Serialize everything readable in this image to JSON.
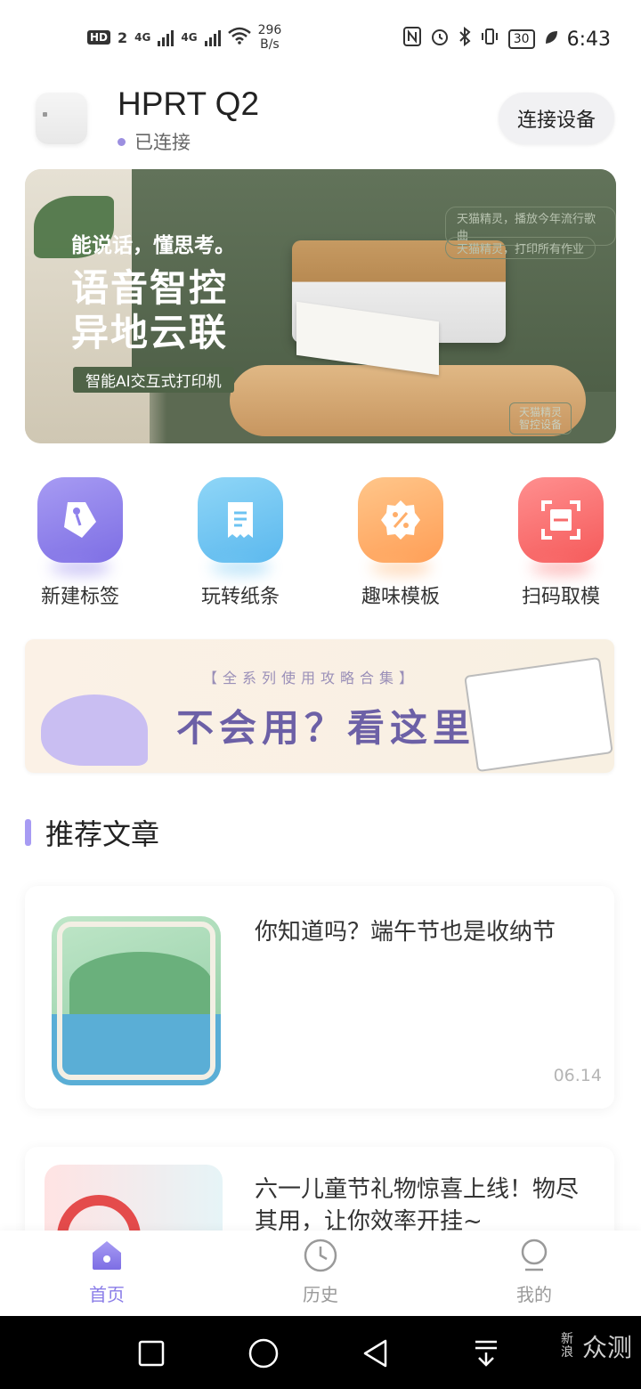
{
  "status_bar": {
    "hd_badge": "HD",
    "sim_slot": "2",
    "net1": "4G",
    "net2": "4G",
    "speed_value": "296",
    "speed_unit": "B/s",
    "battery": "30",
    "time": "6:43"
  },
  "device": {
    "name": "HPRT Q2",
    "status": "已连接",
    "connect_button": "连接设备"
  },
  "banner": {
    "line1": "能说话，懂思考。",
    "line2": "语音智控",
    "line3": "异地云联",
    "tag": "智能AI交互式打印机",
    "right1": "天猫精灵，播放今年流行歌曲",
    "right2": "天猫精灵，打印所有作业",
    "corner_line1": "天猫精灵",
    "corner_line2": "智控设备"
  },
  "quick_actions": [
    {
      "label": "新建标签",
      "icon": "tag-icon",
      "color": "#8f81ec"
    },
    {
      "label": "玩转纸条",
      "icon": "receipt-icon",
      "color": "#6cc3f2"
    },
    {
      "label": "趣味模板",
      "icon": "percent-badge-icon",
      "color": "#ffae6a"
    },
    {
      "label": "扫码取模",
      "icon": "scan-icon",
      "color": "#f76a6a"
    }
  ],
  "guide_banner": {
    "subtitle": "【全系列使用攻略合集】",
    "title": "不会用？看这里"
  },
  "articles_section": {
    "title": "推荐文章"
  },
  "articles": [
    {
      "title": "你知道吗？端午节也是收纳节",
      "date": "06.14"
    },
    {
      "title": "六一儿童节礼物惊喜上线！物尽其用，让你效率开挂~"
    }
  ],
  "tabs": [
    {
      "label": "首页",
      "icon": "home-icon",
      "active": true
    },
    {
      "label": "历史",
      "icon": "clock-icon",
      "active": false
    },
    {
      "label": "我的",
      "icon": "person-icon",
      "active": false
    }
  ],
  "watermark": {
    "small": "新浪",
    "big": "众测"
  },
  "colors": {
    "accent": "#8a7de8",
    "background": "#ffffff"
  }
}
